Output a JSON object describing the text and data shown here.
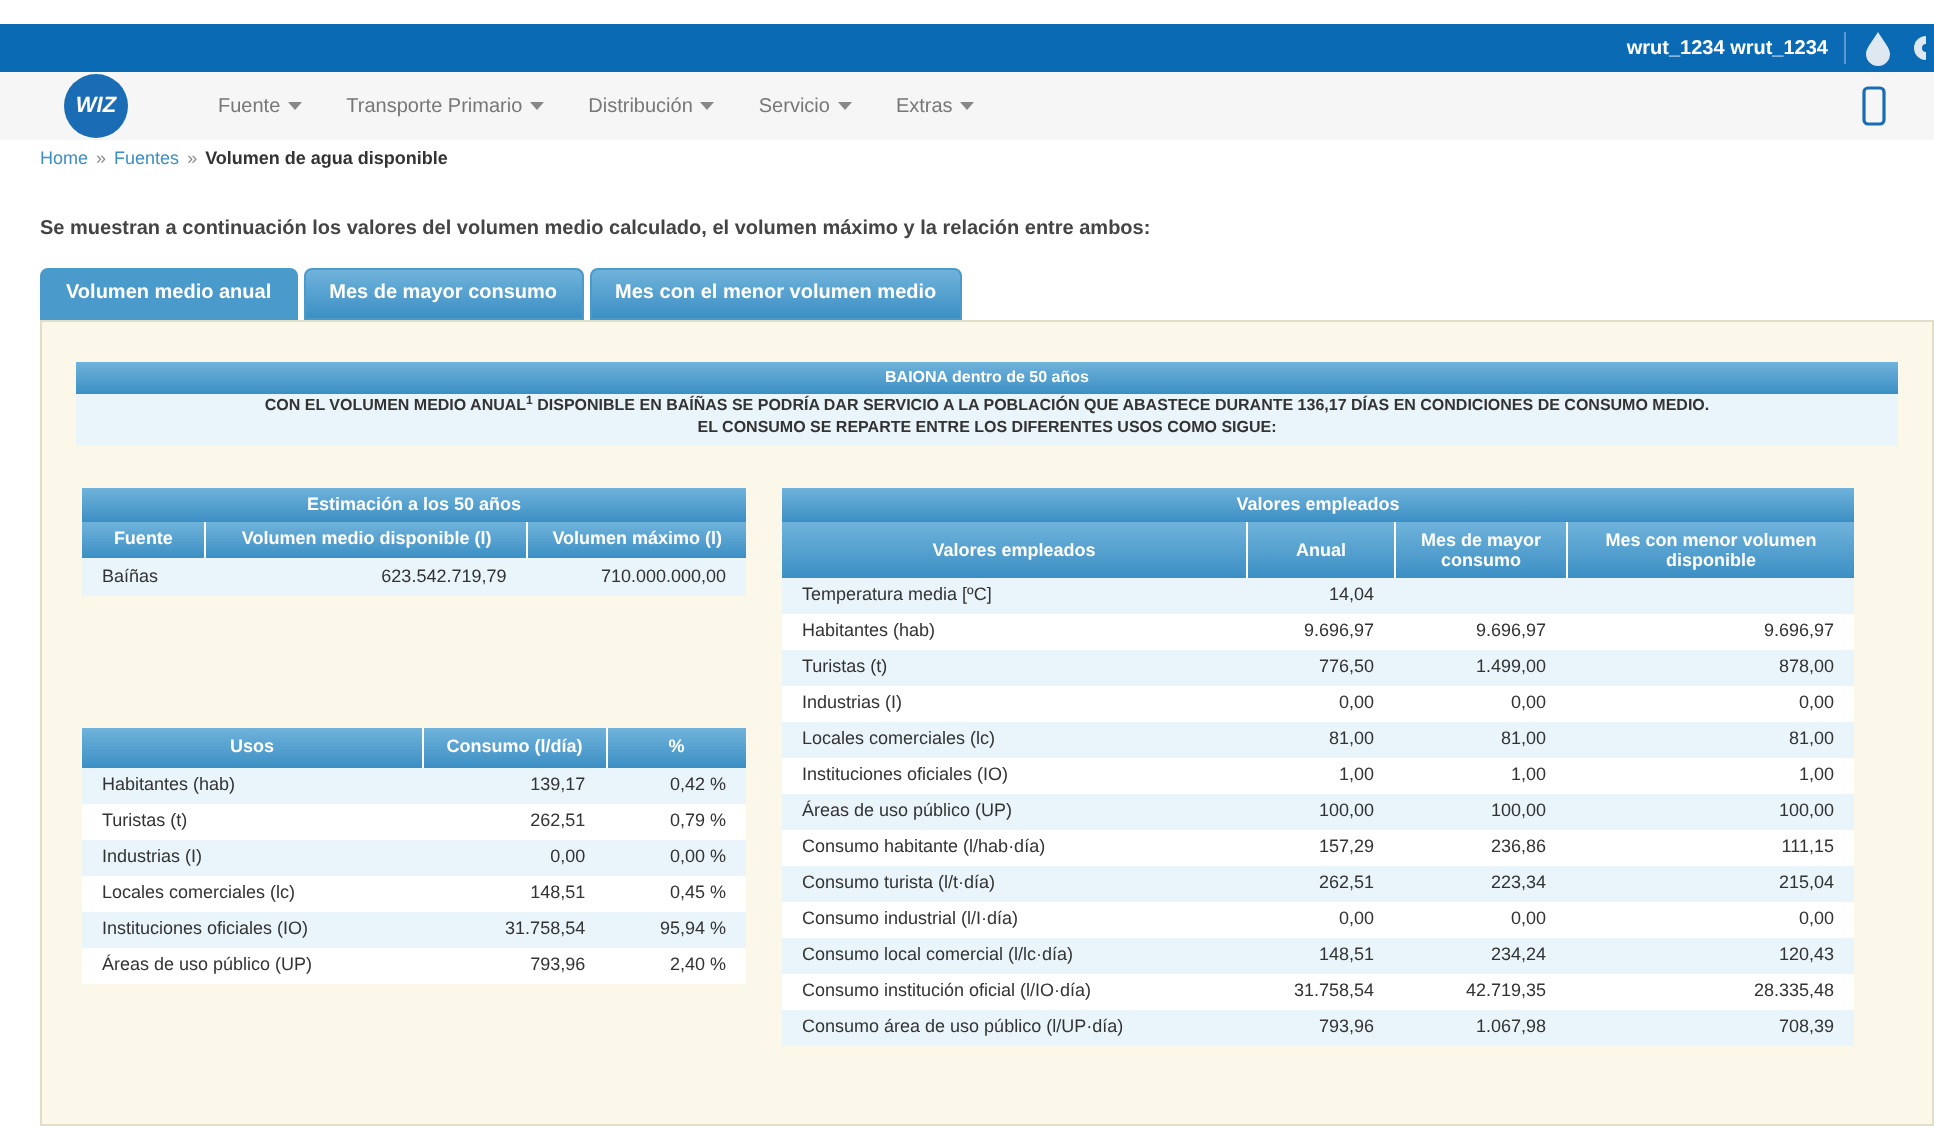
{
  "top_bar": {
    "user": "wrut_1234 wrut_1234"
  },
  "logo": {
    "text": "WIZ"
  },
  "nav": [
    {
      "label": "Fuente"
    },
    {
      "label": "Transporte Primario"
    },
    {
      "label": "Distribución"
    },
    {
      "label": "Servicio"
    },
    {
      "label": "Extras"
    }
  ],
  "breadcrumb": [
    {
      "label": "Home",
      "link": true
    },
    {
      "label": "Fuentes",
      "link": true
    },
    {
      "label": "Volumen de agua disponible",
      "link": false
    }
  ],
  "breadcrumb_separator": "»",
  "intro": "Se muestran a continuación los valores del volumen medio calculado, el volumen máximo y la relación entre ambos:",
  "tabs": [
    {
      "label": "Volumen medio anual",
      "selected": true
    },
    {
      "label": "Mes de mayor consumo",
      "selected": false
    },
    {
      "label": "Mes con el menor volumen medio",
      "selected": false
    }
  ],
  "banner": {
    "title": "BAIONA dentro de 50 años",
    "lines": [
      "CON EL VOLUMEN MEDIO ANUAL$^{1}$ DISPONIBLE EN BAÍÑAS SE PODRÍA DAR SERVICIO A LA POBLACIÓN QUE ABASTECE DURANTE 136,17 DÍAS EN CONDICIONES DE CONSUMO MEDIO.",
      "EL CONSUMO SE REPARTE ENTRE LOS DIFERENTES USOS COMO SIGUE:"
    ]
  },
  "estimation_table": {
    "title": "Estimación a los 50 años",
    "columns": [
      "Fuente",
      "Volumen medio disponible (l)",
      "Volumen máximo (l)"
    ],
    "rows": [
      [
        "Baíñas",
        "623.542.719,79",
        "710.000.000,00"
      ]
    ]
  },
  "uses_table": {
    "columns": [
      "Usos",
      "Consumo (l/día)",
      "%"
    ],
    "rows": [
      [
        "Habitantes (hab)",
        "139,17",
        "0,42 %"
      ],
      [
        "Turistas (t)",
        "262,51",
        "0,79 %"
      ],
      [
        "Industrias (I)",
        "0,00",
        "0,00 %"
      ],
      [
        "Locales comerciales (lc)",
        "148,51",
        "0,45 %"
      ],
      [
        "Instituciones oficiales (IO)",
        "31.758,54",
        "95,94 %"
      ],
      [
        "Áreas de uso público (UP)",
        "793,96",
        "2,40 %"
      ]
    ]
  },
  "values_table": {
    "title": "Valores empleados",
    "columns": [
      "Valores empleados",
      "Anual",
      "Mes de mayor consumo",
      "Mes con menor volumen disponible"
    ],
    "rows": [
      [
        "Temperatura media [ºC]",
        "14,04",
        null,
        null
      ],
      [
        "Habitantes (hab)",
        "9.696,97",
        "9.696,97",
        "9.696,97"
      ],
      [
        "Turistas (t)",
        "776,50",
        "1.499,00",
        "878,00"
      ],
      [
        "Industrias (I)",
        "0,00",
        "0,00",
        "0,00"
      ],
      [
        "Locales comerciales (lc)",
        "81,00",
        "81,00",
        "81,00"
      ],
      [
        "Instituciones oficiales (IO)",
        "1,00",
        "1,00",
        "1,00"
      ],
      [
        "Áreas de uso público (UP)",
        "100,00",
        "100,00",
        "100,00"
      ],
      [
        "Consumo habitante (l/hab·día)",
        "157,29",
        "236,86",
        "111,15"
      ],
      [
        "Consumo turista (l/t·día)",
        "262,51",
        "223,34",
        "215,04"
      ],
      [
        "Consumo industrial (l/I·día)",
        "0,00",
        "0,00",
        "0,00"
      ],
      [
        "Consumo local comercial (l/lc·día)",
        "148,51",
        "234,24",
        "120,43"
      ],
      [
        "Consumo institución oficial (l/IO·día)",
        "31.758,54",
        "42.719,35",
        "28.335,48"
      ],
      [
        "Consumo área de uso público (l/UP·día)",
        "793,96",
        "1.067,98",
        "708,39"
      ]
    ]
  }
}
